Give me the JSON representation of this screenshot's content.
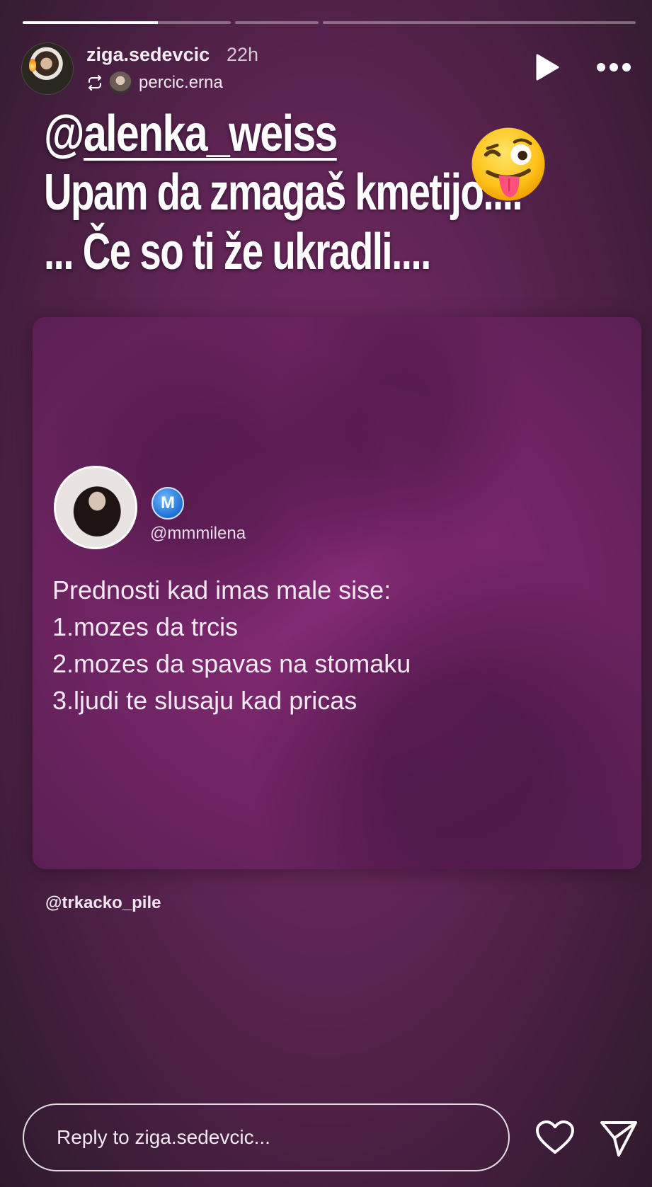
{
  "progress": {
    "segments": [
      0.65,
      0,
      0
    ]
  },
  "header": {
    "username": "ziga.sedevcic",
    "timestamp": "22h",
    "repost_from": "percic.erna"
  },
  "caption": {
    "mention_prefix": "@",
    "mention_handle": "alenka_weiss",
    "line1": "Upam da zmagaš kmetijo....",
    "line2": "... Če so ti že ukradli....",
    "emoji": "winking-face-with-tongue"
  },
  "card": {
    "badge_letter": "M",
    "handle": "@mmmilena",
    "lines": [
      "Prednosti kad imas male sise:",
      "1.mozes da trcis",
      "2.mozes da spavas na stomaku",
      "3.ljudi te slusaju kad pricas"
    ]
  },
  "source_tag": "@trkacko_pile",
  "reply": {
    "placeholder": "Reply to ziga.sedevcic..."
  },
  "colors": {
    "background": "#5e2454",
    "card": "#7b2a6e",
    "text": "#ffffff"
  }
}
